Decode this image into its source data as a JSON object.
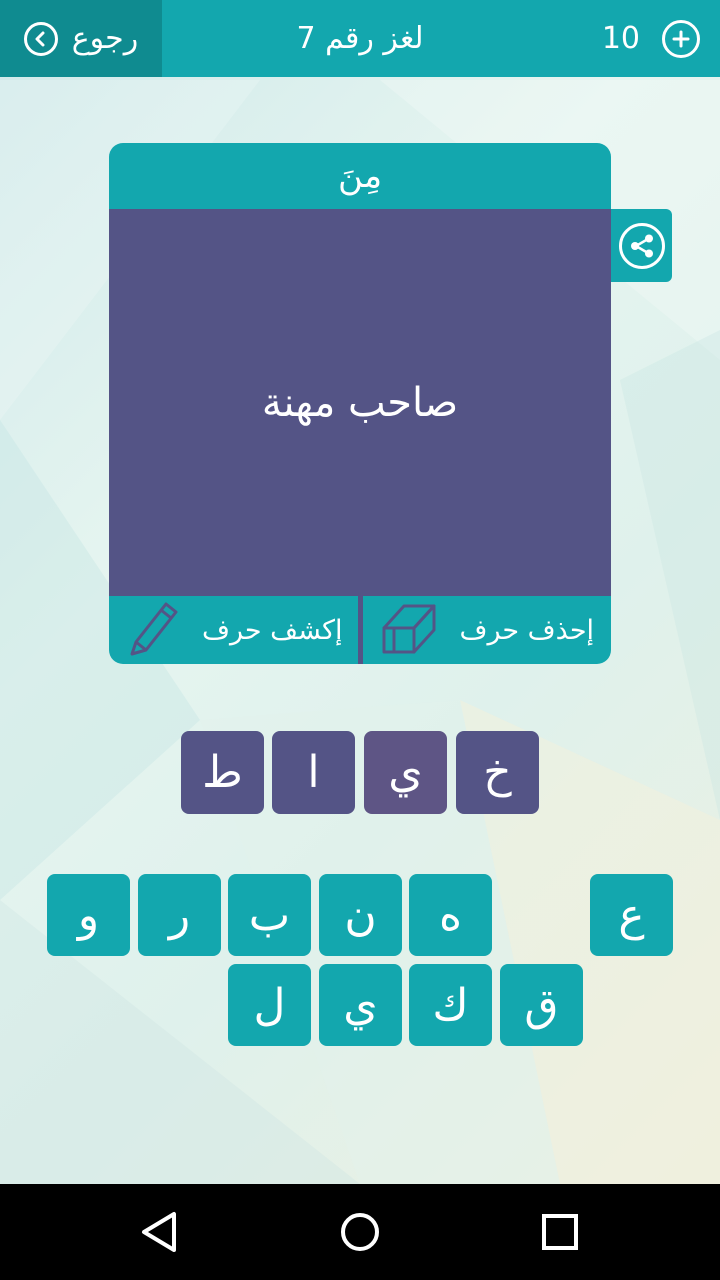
{
  "header": {
    "back_label": "رجوع",
    "title": "لغز رقم 7",
    "coins": "10"
  },
  "card": {
    "category": "مِنَ",
    "clue": "صاحب مهنة",
    "reveal_label": "إكشف حرف",
    "delete_label": "إحذف حرف"
  },
  "answer_slots": [
    "ط",
    "ا",
    "ي",
    "خ"
  ],
  "keyboard": {
    "row1": [
      "و",
      "ر",
      "ب",
      "ن",
      "ه",
      "ع"
    ],
    "row2": [
      "ل",
      "ي",
      "ك",
      "ق"
    ]
  },
  "colors": {
    "teal": "#13a7ae",
    "teal_dark": "#0f8b90",
    "purple": "#545486"
  },
  "icons": {
    "back": "chevron-left-circle-icon",
    "coins": "plus-circle-icon",
    "share": "share-icon",
    "reveal": "pencil-icon",
    "delete": "eraser-icon",
    "nav": [
      "back-triangle-icon",
      "home-circle-icon",
      "recents-square-icon"
    ]
  }
}
